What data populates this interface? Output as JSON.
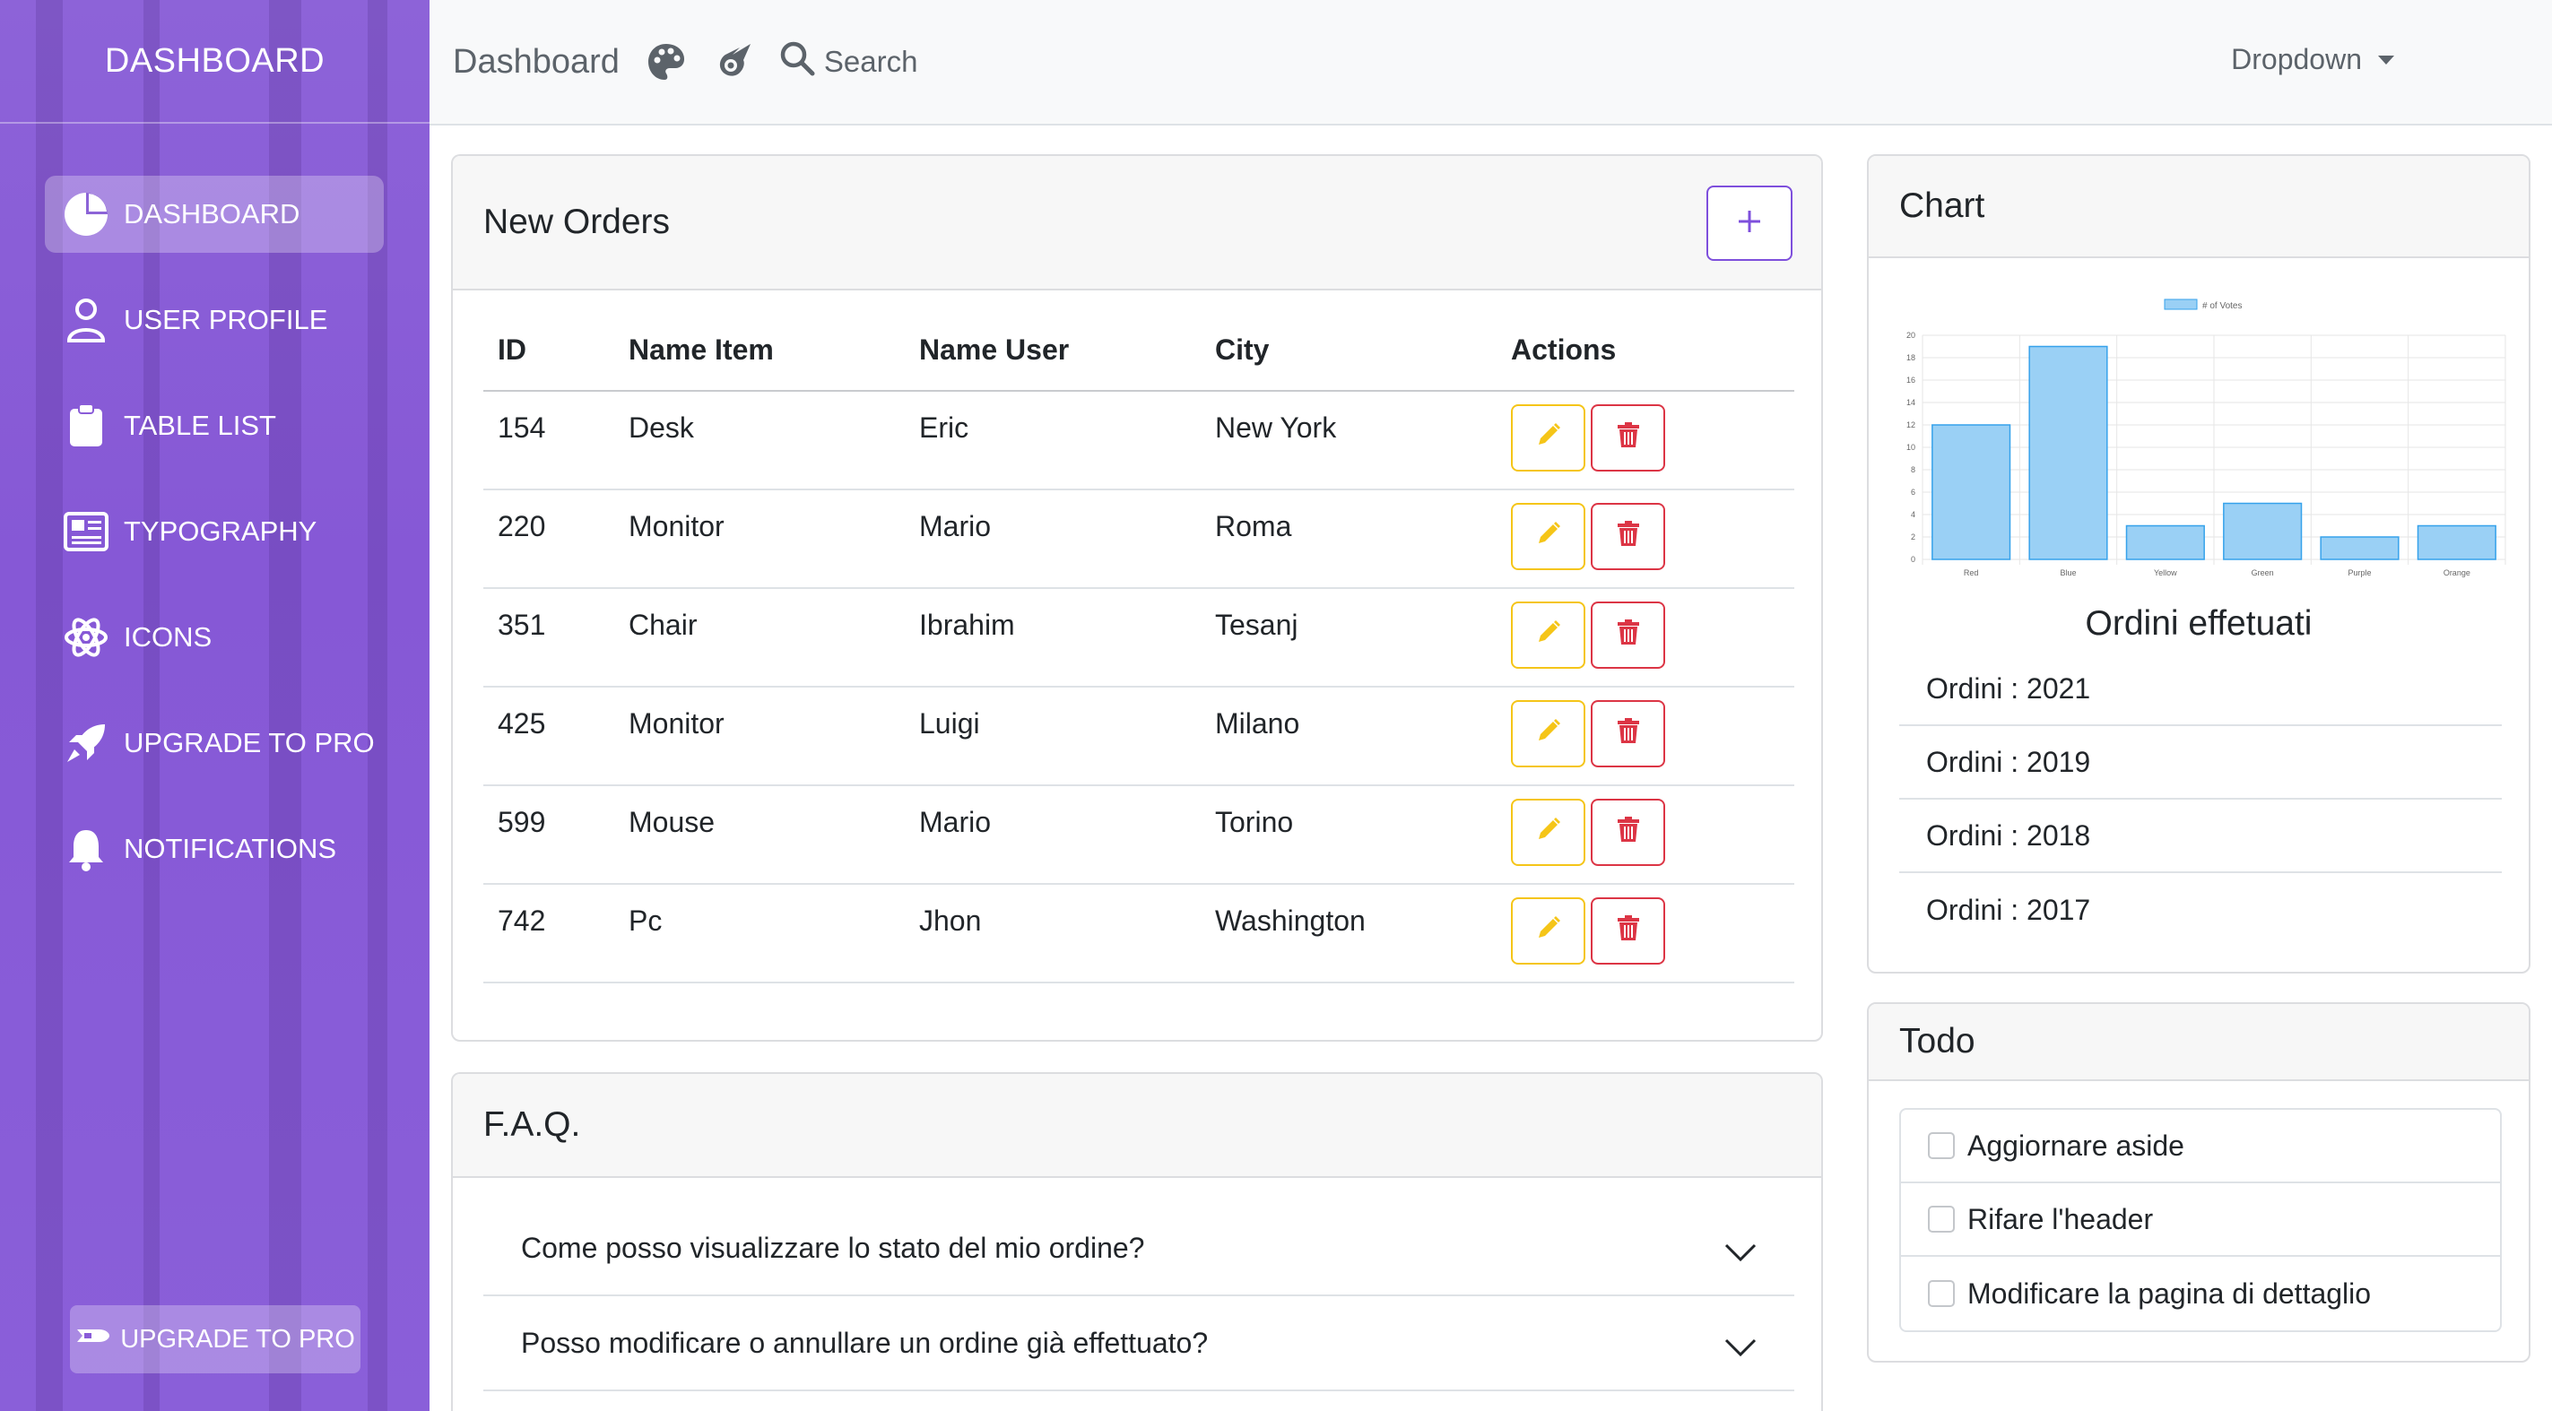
{
  "sidebar": {
    "brand": "DASHBOARD",
    "items": [
      {
        "label": "DASHBOARD",
        "icon": "pie-chart-icon",
        "active": true
      },
      {
        "label": "USER PROFILE",
        "icon": "user-icon"
      },
      {
        "label": "TABLE LIST",
        "icon": "clipboard-icon"
      },
      {
        "label": "TYPOGRAPHY",
        "icon": "newspaper-icon"
      },
      {
        "label": "ICONS",
        "icon": "atom-icon"
      },
      {
        "label": "UPGRADE TO PRO",
        "icon": "rocket-icon"
      },
      {
        "label": "NOTIFICATIONS",
        "icon": "bell-icon"
      }
    ],
    "upgrade_button": "UPGRADE TO PRO"
  },
  "header": {
    "title": "Dashboard",
    "search_label": "Search",
    "dropdown_label": "Dropdown"
  },
  "orders": {
    "title": "New Orders",
    "columns": [
      "ID",
      "Name Item",
      "Name User",
      "City",
      "Actions"
    ],
    "rows": [
      [
        "154",
        "Desk",
        "Eric",
        "New York"
      ],
      [
        "220",
        "Monitor",
        "Mario",
        "Roma"
      ],
      [
        "351",
        "Chair",
        "Ibrahim",
        "Tesanj"
      ],
      [
        "425",
        "Monitor",
        "Luigi",
        "Milano"
      ],
      [
        "599",
        "Mouse",
        "Mario",
        "Torino"
      ],
      [
        "742",
        "Pc",
        "Jhon",
        "Washington"
      ]
    ]
  },
  "faq": {
    "title": "F.A.Q.",
    "items": [
      "Come posso visualizzare lo stato del mio ordine?",
      "Posso modificare o annullare un ordine già effettuato?"
    ]
  },
  "chart_card": {
    "title": "Chart",
    "caption": "Ordini effetuati",
    "ordini": [
      "Ordini : 2021",
      "Ordini : 2019",
      "Ordini : 2018",
      "Ordini : 2017"
    ]
  },
  "chart_data": {
    "type": "bar",
    "categories": [
      "Red",
      "Blue",
      "Yellow",
      "Green",
      "Purple",
      "Orange"
    ],
    "series": [
      {
        "name": "# of Votes",
        "values": [
          12,
          19,
          3,
          5,
          2,
          3
        ]
      }
    ],
    "ylim": [
      0,
      20
    ],
    "yticks": [
      0,
      2,
      4,
      6,
      8,
      10,
      12,
      14,
      16,
      18,
      20
    ],
    "legend": "top",
    "grid": true,
    "color": "#9ad0f5"
  },
  "todo": {
    "title": "Todo",
    "items": [
      "Aggiornare aside",
      "Rifare l'header",
      "Modificare la pagina di dettaglio"
    ]
  },
  "colors": {
    "sidebar": "#8a5cd8",
    "accent": "#7e4fdc",
    "edit": "#f5c518",
    "delete": "#dc3545"
  }
}
